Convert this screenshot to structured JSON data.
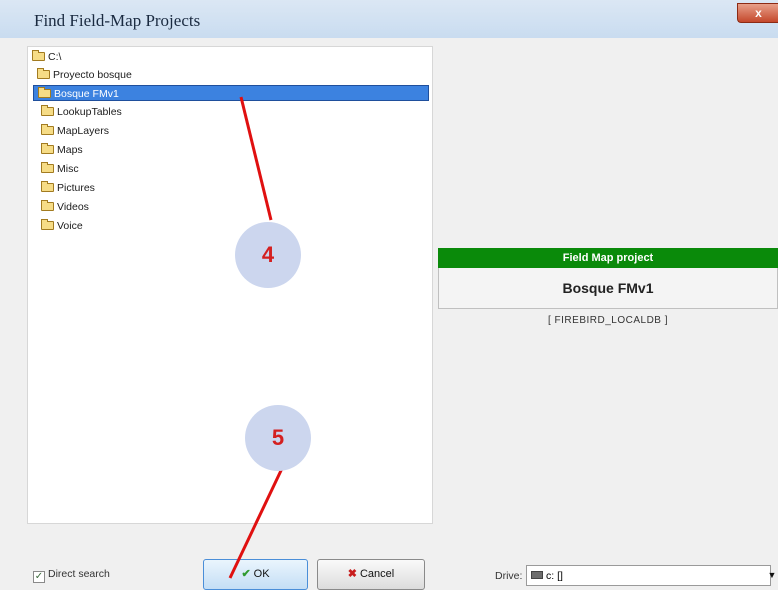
{
  "window": {
    "title": "Find Field-Map Projects",
    "close_label": "x"
  },
  "tree": {
    "items": [
      {
        "label": "C:\\"
      },
      {
        "label": "Proyecto bosque"
      },
      {
        "label": "Bosque FMv1"
      },
      {
        "label": "LookupTables"
      },
      {
        "label": "MapLayers"
      },
      {
        "label": "Maps"
      },
      {
        "label": "Misc"
      },
      {
        "label": "Pictures"
      },
      {
        "label": "Videos"
      },
      {
        "label": "Voice"
      }
    ]
  },
  "project_panel": {
    "header": "Field Map project",
    "name": "Bosque FMv1",
    "database": "[ FIREBIRD_LOCALDB ]"
  },
  "footer": {
    "direct_search_label": "Direct search",
    "direct_search_checked": true,
    "ok_label": "OK",
    "cancel_label": "Cancel",
    "drive_label": "Drive:",
    "drive_value": "c: []"
  },
  "annotations": {
    "callout_4": "4",
    "callout_5": "5"
  },
  "colors": {
    "selection": "#3c82e0",
    "project_header": "#0a8a0a",
    "annotation": "#e01010"
  }
}
